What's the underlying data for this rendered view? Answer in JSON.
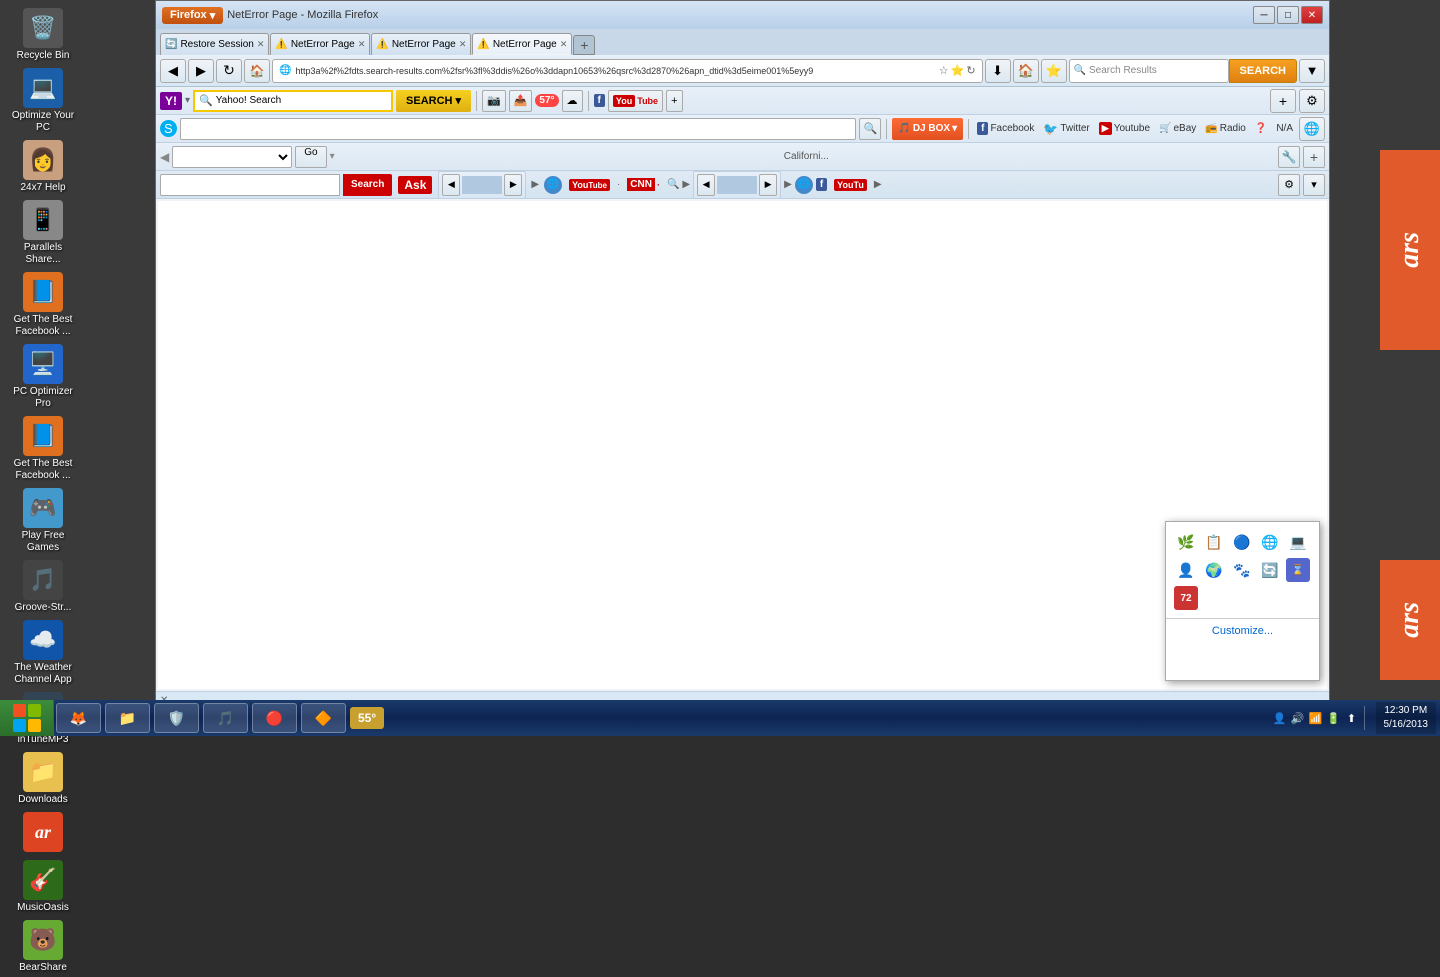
{
  "desktop": {
    "background": "#3a3a3a"
  },
  "icons": [
    {
      "id": "recycle-bin",
      "label": "Recycle Bin",
      "emoji": "🗑️",
      "col": 0
    },
    {
      "id": "optimize-pc",
      "label": "Optimize Your PC",
      "emoji": "💻",
      "col": 1
    },
    {
      "id": "24x7-help",
      "label": "24x7 Help",
      "emoji": "👩",
      "col": 0
    },
    {
      "id": "parallels-share",
      "label": "Parallels Share...",
      "emoji": "📱",
      "col": 1
    },
    {
      "id": "get-facebook-1",
      "label": "Get The Best Facebook ...",
      "emoji": "📘",
      "col": 0
    },
    {
      "id": "pc-optimizer-pro",
      "label": "PC Optimizer Pro",
      "emoji": "⚙️",
      "col": 1
    },
    {
      "id": "get-facebook-2",
      "label": "Get The Best Facebook ...",
      "emoji": "📘",
      "col": 0
    },
    {
      "id": "play-free-games",
      "label": "Play Free Games",
      "emoji": "🎮",
      "col": 1
    },
    {
      "id": "groove-str",
      "label": "Groove-Str...",
      "emoji": "🎵",
      "col": 0
    },
    {
      "id": "weather-channel",
      "label": "The Weather Channel App",
      "emoji": "☁️",
      "col": 1
    },
    {
      "id": "itune-mp3",
      "label": "inTuneMP3",
      "emoji": "🎵",
      "col": 0
    },
    {
      "id": "downloads",
      "label": "Downloads",
      "emoji": "📁",
      "col": 1
    },
    {
      "id": "ars-icon",
      "label": "ar",
      "emoji": "📰",
      "col": 0
    },
    {
      "id": "musicoasis",
      "label": "MusicOasis",
      "emoji": "🎸",
      "col": 0
    },
    {
      "id": "bearshare",
      "label": "BearShare",
      "emoji": "🐻",
      "col": 1
    }
  ],
  "browser": {
    "title": "NetError Page - Mozilla Firefox",
    "tabs": [
      {
        "label": "Restore Session",
        "favicon": "🔄",
        "active": false,
        "closable": true
      },
      {
        "label": "NetError Page",
        "favicon": "⚠️",
        "active": false,
        "closable": true
      },
      {
        "label": "NetError Page",
        "favicon": "⚠️",
        "active": false,
        "closable": true
      },
      {
        "label": "NetError Page",
        "favicon": "⚠️",
        "active": true,
        "closable": true
      }
    ],
    "url": "http3a%2f%2fdts.search-results.com%2fsr%3fl%3ddis%26o%3ddapn10653%26qsrc%3d2870%26apn_dtid%3d5eime001%5eyy9",
    "search_placeholder": "Search Results",
    "toolbar": {
      "yahoo_label": "Yahoo! Search",
      "search_btn": "SEARCH",
      "temp": "57°",
      "djbox_label": "DJ BOX",
      "facebook_label": "Facebook",
      "twitter_label": "Twitter",
      "youtube_label": "Youtube",
      "ebay_label": "eBay",
      "radio_label": "Radio",
      "na_label": "N/A",
      "california_label": "Californi...",
      "go_label": "Go",
      "search_label": "Search",
      "ask_label": "Ask"
    },
    "toolbar4": {
      "youtube_label": "YouTube",
      "cnn_label": "CNN",
      "facebook_label": "F",
      "youtube2_label": "YouTu"
    }
  },
  "taskbar": {
    "time": "12:30 PM",
    "date": "5/16/2013",
    "temperature": "55°",
    "taskbar_items": [
      {
        "label": "Firefox",
        "emoji": "🦊"
      },
      {
        "label": "Explorer",
        "emoji": "📁"
      },
      {
        "label": "Avg",
        "emoji": "🛡️"
      }
    ]
  },
  "systray": {
    "customize_label": "Customize...",
    "icons": [
      "🌿",
      "📋",
      "🔵",
      "🌐",
      "💻",
      "👤",
      "🌍",
      "🐾",
      "🔄",
      "⌛",
      "72"
    ]
  },
  "ars": {
    "text": "ars"
  }
}
